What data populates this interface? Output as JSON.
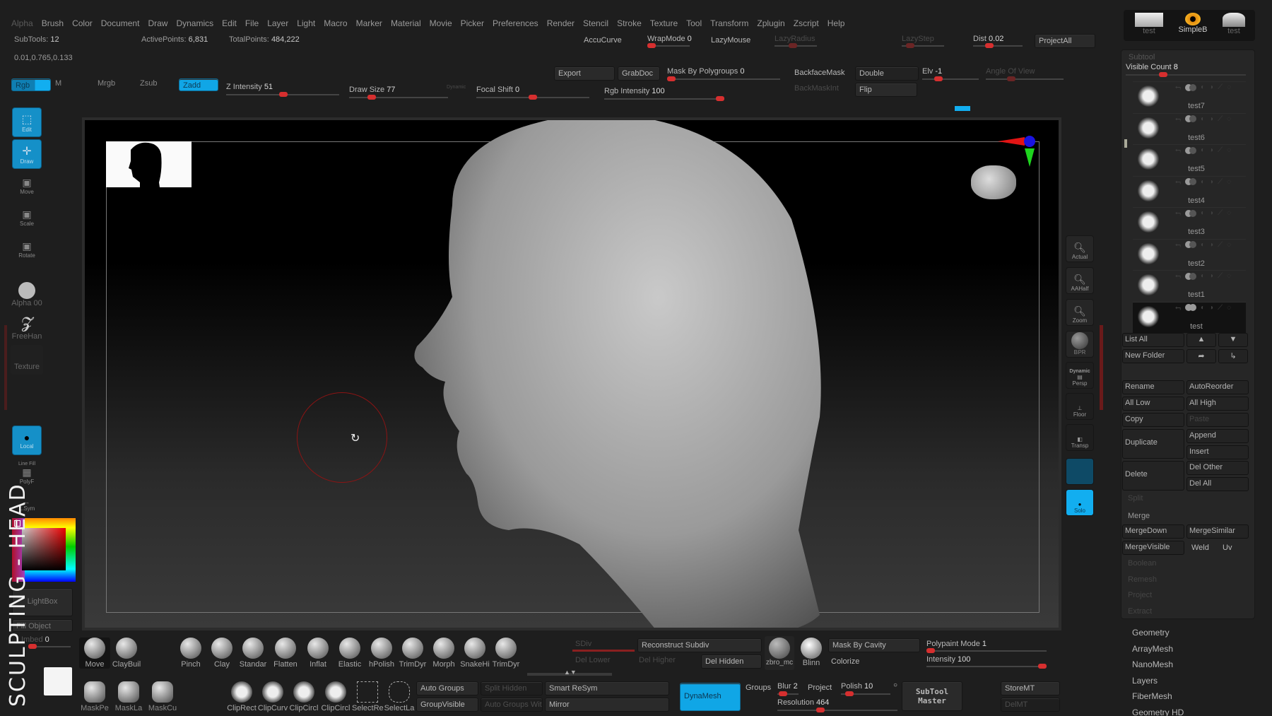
{
  "menu": [
    "Alpha",
    "Brush",
    "Color",
    "Document",
    "Draw",
    "Dynamics",
    "Edit",
    "File",
    "Layer",
    "Light",
    "Macro",
    "Marker",
    "Material",
    "Movie",
    "Picker",
    "Preferences",
    "Render",
    "Stencil",
    "Stroke",
    "Texture",
    "Tool",
    "Transform",
    "Zplugin",
    "Zscript",
    "Help"
  ],
  "info": {
    "subtools_label": "SubTools:",
    "subtools_value": "12",
    "active_label": "ActivePoints:",
    "active_value": "6,831",
    "total_label": "TotalPoints:",
    "total_value": "484,222",
    "coords": "0.01,0.765,0.133"
  },
  "stroke": {
    "accucurve": "AccuCurve",
    "wrapmode_label": "WrapMode",
    "wrapmode_value": "0",
    "lazymouse": "LazyMouse",
    "lazyradius": "LazyRadius",
    "lazystep": "LazyStep",
    "dist_label": "Dist",
    "dist_value": "0.02",
    "projectall": "ProjectAll"
  },
  "draw_bar": {
    "rgb": "Rgb",
    "m": "M",
    "mrgb": "Mrgb",
    "zsub": "Zsub",
    "zadd": "Zadd",
    "zintensity_label": "Z Intensity",
    "zintensity_value": "51",
    "drawsize_label": "Draw Size",
    "drawsize_value": "77",
    "dynamic": "Dynamic",
    "focal_label": "Focal Shift",
    "focal_value": "0",
    "rgbint_label": "Rgb Intensity",
    "rgbint_value": "100",
    "export": "Export",
    "grabdoc": "GrabDoc",
    "maskpoly_label": "Mask By Polygroups",
    "maskpoly_value": "0",
    "backfacemask": "BackfaceMask",
    "double": "Double",
    "backmaskint": "BackMaskInt",
    "flip": "Flip",
    "elv_label": "Elv",
    "elv_value": "-1",
    "angle_of_view": "Angle Of View"
  },
  "sliders": {
    "wrapmode": 0.0,
    "z_intensity": 0.51,
    "draw_size": 0.2,
    "focal_shift": 0.5,
    "rgb_intensity": 1.0,
    "dist": 0.3,
    "elv": 0.25,
    "mask_polygroups": 0.0,
    "polypaint_mode": 0.0,
    "intensity": 1.0,
    "blur": 0.1,
    "polish": 0.1,
    "resolution": 0.35,
    "imbed": 0.0,
    "visible_count": 0.3
  },
  "left_tools": [
    {
      "name": "edit",
      "label": "Edit",
      "active": true
    },
    {
      "name": "draw",
      "label": "Draw",
      "active": true
    },
    {
      "name": "move",
      "label": "Move",
      "active": false
    },
    {
      "name": "scale",
      "label": "Scale",
      "active": false
    },
    {
      "name": "rotate",
      "label": "Rotate",
      "active": false
    }
  ],
  "left_panel": {
    "alpha": "Alpha 00",
    "stroke": "FreeHan",
    "texture": "Texture",
    "local": "Local",
    "linefill": "Line Fill",
    "polyf": "PolyF",
    "lsym": "L.Sym",
    "lightbox": "LightBox",
    "fillobject": "Fill Object",
    "imbed_label": "Imbed",
    "imbed_value": "0",
    "overlay_title": "SCULPTING - HEAD"
  },
  "right_nav": [
    "Actual",
    "AAHalf",
    "Zoom",
    "BPR",
    "Persp",
    "Floor",
    "Transp",
    "",
    "Solo"
  ],
  "right_nav_dynamic": "Dynamic",
  "tool_thumbs": [
    {
      "label": "test"
    },
    {
      "label": "SimpleB"
    },
    {
      "label": "test"
    }
  ],
  "subtool": {
    "title": "Subtool",
    "visible_count_label": "Visible Count",
    "visible_count_value": "8",
    "items": [
      "test7",
      "test6",
      "test5",
      "test4",
      "test3",
      "test2",
      "test1",
      "test"
    ],
    "active": "test",
    "buttons": {
      "list_all": "List All",
      "new_folder": "New Folder",
      "rename": "Rename",
      "autoreorder": "AutoReorder",
      "all_low": "All Low",
      "all_high": "All High",
      "copy": "Copy",
      "paste": "Paste",
      "duplicate": "Duplicate",
      "append": "Append",
      "insert": "Insert",
      "delete": "Delete",
      "del_other": "Del Other",
      "del_all": "Del All",
      "split": "Split",
      "merge": "Merge",
      "mergedown": "MergeDown",
      "mergesimilar": "MergeSimilar",
      "mergevisible": "MergeVisible",
      "weld": "Weld",
      "uv": "Uv",
      "boolean": "Boolean",
      "remesh": "Remesh",
      "project": "Project",
      "extract": "Extract"
    }
  },
  "tool_submenus": [
    "Geometry",
    "ArrayMesh",
    "NanoMesh",
    "Layers",
    "FiberMesh",
    "Geometry HD"
  ],
  "brushes": [
    "Move",
    "ClayBuil",
    "Pinch",
    "Clay",
    "Standar",
    "Flatten",
    "Inflat",
    "Elastic",
    "hPolish",
    "TrimDyr",
    "Morph",
    "SnakeHi",
    "TrimDyr"
  ],
  "mask_brushes": [
    "MaskPe",
    "MaskLa",
    "MaskCu"
  ],
  "clip_brushes": [
    "ClipRect",
    "ClipCurv",
    "ClipCircl",
    "ClipCircl",
    "SelectRe",
    "SelectLa"
  ],
  "bottom": {
    "auto_groups": "Auto Groups",
    "split_hidden": "Split Hidden",
    "group_visible": "GroupVisible",
    "auto_groups_wit": "Auto Groups Wit",
    "smart_resym": "Smart ReSym",
    "mirror": "Mirror",
    "sdiv": "SDiv",
    "reconstruct": "Reconstruct Subdiv",
    "del_lower": "Del Lower",
    "del_higher": "Del Higher",
    "del_hidden": "Del Hidden",
    "material": "zbro_mc",
    "blinn": "Blinn",
    "mask_cavity": "Mask By Cavity",
    "colorize": "Colorize",
    "polypaint_label": "Polypaint Mode",
    "polypaint_value": "1",
    "intensity_label": "Intensity",
    "intensity_value": "100",
    "dynamesh": "DynaMesh",
    "groups": "Groups",
    "blur_label": "Blur",
    "blur_value": "2",
    "project": "Project",
    "polish_label": "Polish",
    "polish_value": "10",
    "resolution_label": "Resolution",
    "resolution_value": "464",
    "subtool_master": "SubTool Master",
    "storemt": "StoreMT",
    "delmt": "DelMT"
  },
  "colors": {
    "accent_blue": "#10a6e6",
    "slider_red": "#d62f2f",
    "bg": "#1e1e1e"
  }
}
